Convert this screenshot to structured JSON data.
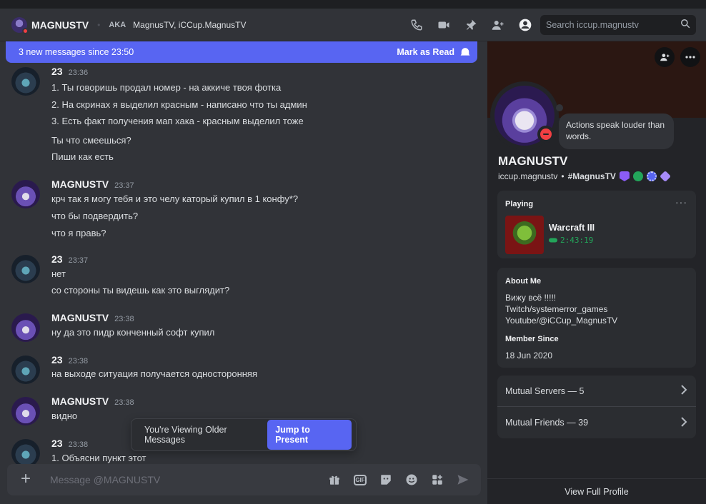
{
  "header": {
    "name": "MAGNUSTV",
    "aka_label": "AKA",
    "aka_names": "MagnusTV, iCCup.MagnusTV",
    "icons": [
      "phone-call-icon",
      "video-call-icon",
      "pin-icon",
      "add-friends-to-dm-icon",
      "user-profile-icon"
    ],
    "search_placeholder": "Search iccup.magnustv"
  },
  "chat": {
    "new_banner": {
      "text": "3 new messages since 23:50",
      "action": "Mark as Read"
    },
    "messages": [
      {
        "author": "23",
        "time": "23:36",
        "avatar": "user23",
        "lines": [
          "1. Ты говоришь продал номер - на аккиче твоя фотка",
          "2. На скринах я выделил красным - написано что ты админ",
          "3. Есть факт получения мап хака - красным выделил тоже",
          "Ты что смеешься?",
          "Пиши как есть"
        ]
      },
      {
        "author": "MAGNUSTV",
        "time": "23:37",
        "avatar": "magnus",
        "lines": [
          "крч так я могу тебя и это челу каторый купил в 1 конфу*?",
          "что бы подвердить?",
          "что я правь?"
        ]
      },
      {
        "author": "23",
        "time": "23:37",
        "avatar": "user23",
        "lines": [
          "нет",
          "со стороны ты видешь как это выглядит?"
        ]
      },
      {
        "author": "MAGNUSTV",
        "time": "23:38",
        "avatar": "magnus",
        "lines": [
          "ну да это пидр конченный софт купил"
        ]
      },
      {
        "author": "23",
        "time": "23:38",
        "avatar": "user23",
        "lines": [
          "на выходе ситуация получается односторонняя"
        ]
      },
      {
        "author": "MAGNUSTV",
        "time": "23:38",
        "avatar": "magnus",
        "lines": [
          "видно"
        ]
      },
      {
        "author": "23",
        "time": "23:38",
        "avatar": "user23",
        "lines": [
          "1. Объясни пункт этот"
        ]
      }
    ],
    "older_notice": {
      "text": "You're Viewing Older Messages",
      "action": "Jump to Present"
    },
    "composer": {
      "placeholder": "Message @MAGNUSTV"
    }
  },
  "profile": {
    "status_bubble": "Actions speak louder than words.",
    "display_name": "MAGNUSTV",
    "username": "iccup.magnustv",
    "separator": "•",
    "tag": "#MagnusTV",
    "badge_colors": [
      "#8b5cf6",
      "#23a55a",
      "#5865f2",
      "#a78bfa"
    ],
    "activity": {
      "label": "Playing",
      "game": "Warcraft III",
      "elapsed": "2:43:19"
    },
    "about": {
      "label": "About Me",
      "lines": [
        "Вижу всё !!!!!",
        "Twitch/systemerror_games",
        "Youtube/@iCCup_MagnusTV"
      ],
      "member_since_label": "Member Since",
      "member_since": "18 Jun 2020"
    },
    "mutual_servers": "Mutual Servers — 5",
    "mutual_friends": "Mutual Friends — 39",
    "view_full": "View Full Profile"
  },
  "colors": {
    "accent": "#5865f2",
    "dnd": "#f23f43",
    "online_green": "#23a55a"
  }
}
